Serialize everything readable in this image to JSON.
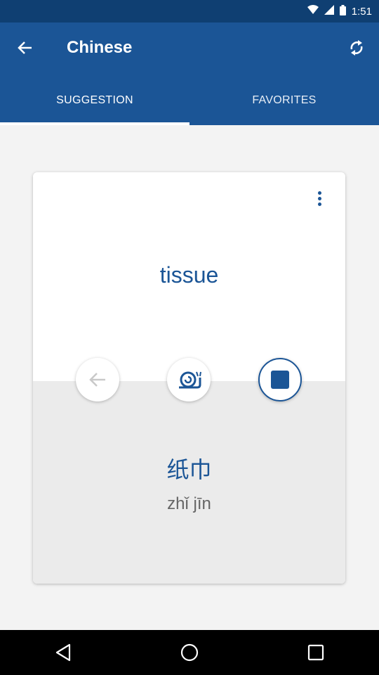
{
  "status_bar": {
    "time": "1:51"
  },
  "app_bar": {
    "title": "Chinese",
    "tabs": [
      {
        "label": "SUGGESTION",
        "selected": true
      },
      {
        "label": "FAVORITES",
        "selected": false
      }
    ]
  },
  "card": {
    "word": "tissue",
    "translation": "纸巾",
    "pinyin": "zhǐ jīn"
  },
  "colors": {
    "primary": "#1b5596",
    "status_bar": "#0f3f72",
    "card_bottom": "#ebebeb"
  },
  "icons": {
    "status": [
      "wifi-icon",
      "signal-icon",
      "battery-icon"
    ],
    "app_bar": [
      "back-arrow-icon",
      "refresh-icon"
    ],
    "card": [
      "more-vert-icon",
      "previous-arrow-icon",
      "snail-icon",
      "stop-icon"
    ],
    "nav": [
      "back-triangle-icon",
      "home-circle-icon",
      "recents-square-icon"
    ]
  }
}
